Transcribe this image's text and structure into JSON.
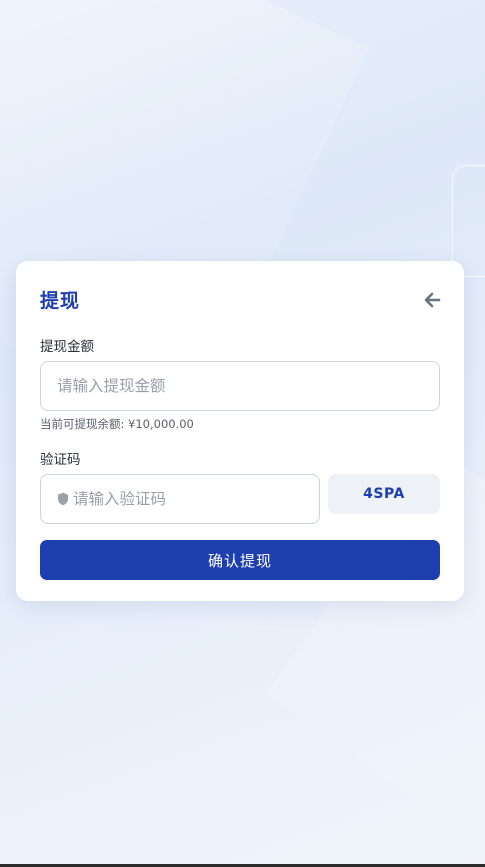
{
  "withdraw_form": {
    "title": "提现",
    "amount": {
      "label": "提现金额",
      "placeholder": "请输入提现金额",
      "value": ""
    },
    "balance_hint": "当前可提现余额: ¥10,000.00",
    "captcha": {
      "label": "验证码",
      "placeholder": "请输入验证码",
      "value": "",
      "code": "4SPA"
    },
    "submit_label": "确认提现"
  },
  "icons": {
    "back": "arrow-left-icon",
    "captcha_field": "shield-icon"
  },
  "colors": {
    "accent": "#1e3fb0",
    "background": "#e2ebf8",
    "card": "#ffffff",
    "label_text": "#2a2f3a",
    "placeholder": "#9aa0a8",
    "border": "#cfd4dc",
    "captcha_bg": "#eef1f5",
    "back_icon": "#6b7180"
  }
}
